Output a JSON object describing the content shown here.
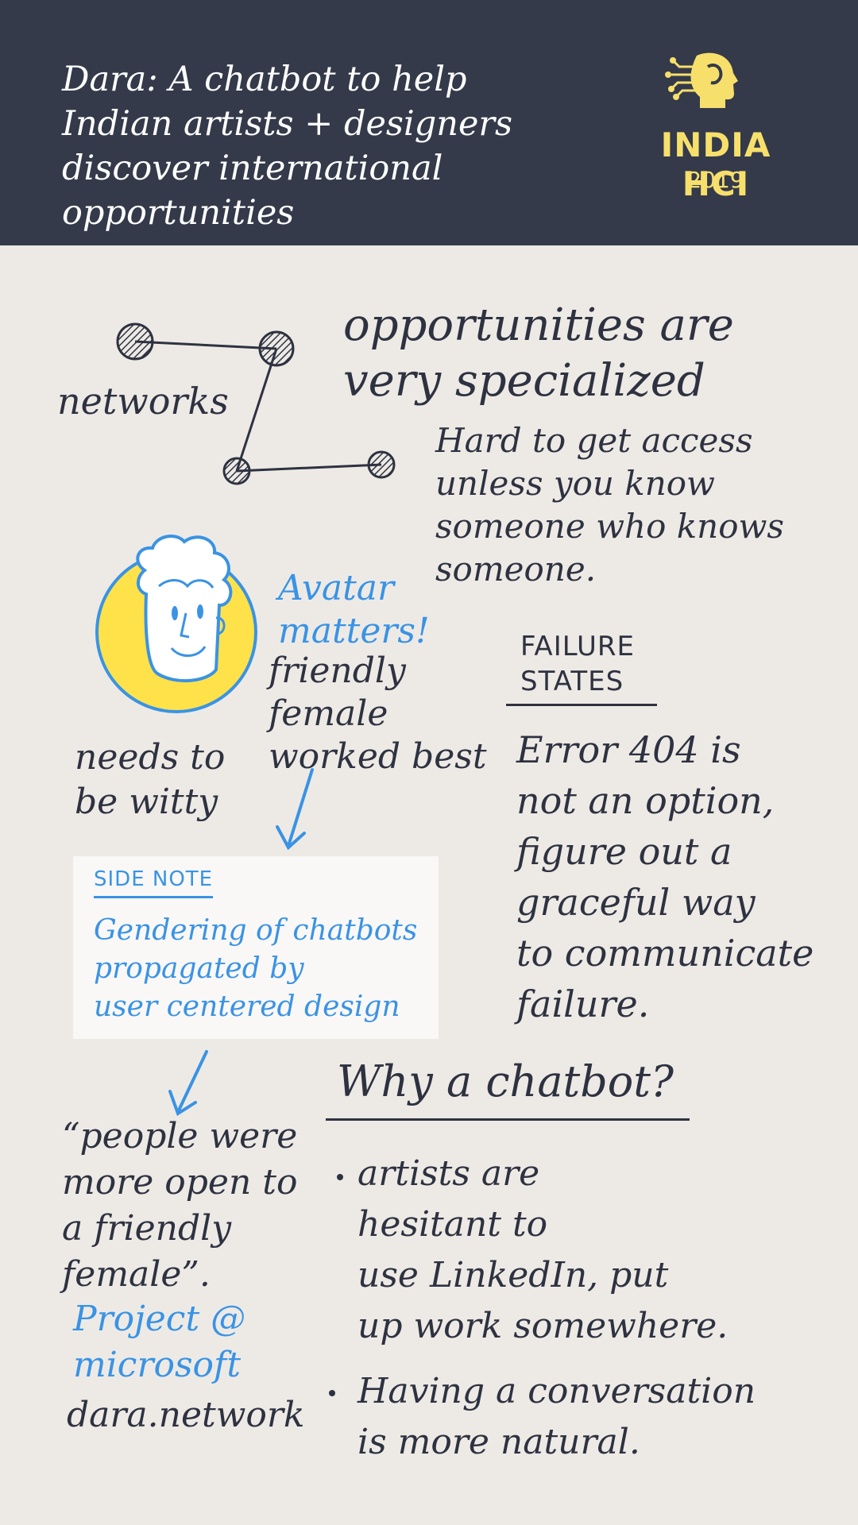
{
  "header": {
    "title_lines": [
      "Dara: A chatbot to help",
      "Indian artists + designers",
      "discover international opportunities"
    ],
    "logo": {
      "name": "INDIA HCI",
      "year": "2019",
      "icon": "ai-head-circuit-icon"
    }
  },
  "networks": {
    "label": "networks",
    "heading_lines": [
      "opportunities are",
      "very specialized"
    ],
    "body_lines": [
      "Hard to get access",
      "unless you know",
      "someone who knows",
      "someone."
    ]
  },
  "avatar": {
    "icon": "smiling-face-avatar-icon",
    "note_lines": [
      "Avatar",
      "matters!"
    ],
    "detail_lines": [
      "friendly",
      "female",
      "worked best"
    ],
    "witty_lines": [
      "needs to",
      "be witty"
    ]
  },
  "failure_states": {
    "title_lines": [
      "FAILURE",
      "STATES"
    ],
    "body_lines": [
      "Error 404 is",
      "not an option,",
      "figure out a",
      "graceful way",
      "to communicate",
      "failure."
    ]
  },
  "side_note": {
    "title": "SIDE NOTE",
    "body_lines": [
      "Gendering of chatbots",
      "propagated by",
      "user centered design"
    ]
  },
  "quote": {
    "lines": [
      "“people were",
      "more open to",
      "a friendly",
      "female”."
    ]
  },
  "project": {
    "lines": [
      "Project @",
      "microsoft"
    ],
    "url": "dara.network"
  },
  "why_chatbot": {
    "title": "Why a chatbot?",
    "bullets": [
      {
        "lines": [
          "artists are",
          "hesitant to",
          "use LinkedIn, put",
          "up work somewhere."
        ]
      },
      {
        "lines": [
          "Having a conversation",
          "is more natural."
        ]
      }
    ]
  },
  "colors": {
    "header_bg": "#343a4a",
    "page_bg": "#edeae6",
    "ink": "#2e3240",
    "accent_blue": "#3a93e4",
    "logo_yellow": "#f7df6c",
    "avatar_yellow": "#ffe24a"
  }
}
